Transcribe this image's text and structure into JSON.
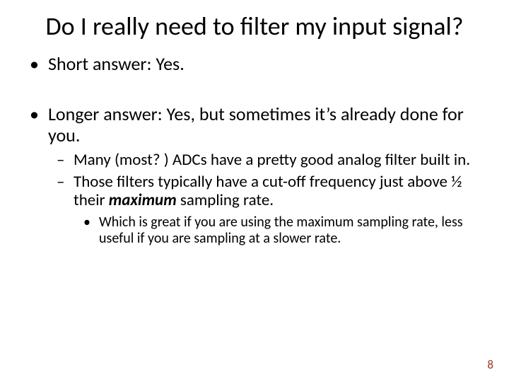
{
  "title": "Do I really need to filter my input signal?",
  "bullets": [
    {
      "text": "Short answer: Yes."
    },
    {
      "text": "Longer answer: Yes, but sometimes it’s already done for you.",
      "sub": [
        {
          "text": "Many (most? ) ADCs have a pretty good analog filter built in."
        },
        {
          "prefix": "Those filters typically have a cut-off frequency just above ½ their ",
          "emph": "maximum",
          "suffix": " sampling rate.",
          "sub": [
            {
              "text": "Which is great if you are using the maximum sampling rate, less useful if you are sampling at a slower rate."
            }
          ]
        }
      ]
    }
  ],
  "page_number": "8"
}
